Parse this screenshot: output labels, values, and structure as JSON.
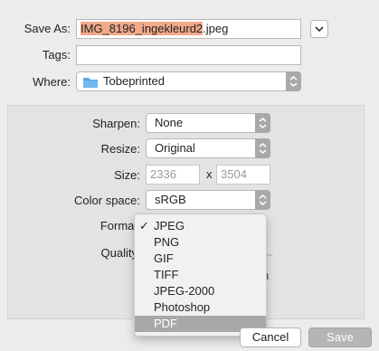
{
  "save_as": {
    "label": "Save As:",
    "filename_selected": "IMG_8196_ingekleurd2",
    "filename_ext": ".jpeg"
  },
  "tags": {
    "label": "Tags:",
    "value": ""
  },
  "where": {
    "label": "Where:",
    "folder": "Tobeprinted"
  },
  "options": {
    "sharpen": {
      "label": "Sharpen:",
      "value": "None"
    },
    "resize": {
      "label": "Resize:",
      "value": "Original"
    },
    "size": {
      "label": "Size:",
      "width": "2336",
      "separator": "x",
      "height": "3504"
    },
    "color_space": {
      "label": "Color space:",
      "value": "sRGB"
    },
    "format": {
      "label": "Format"
    },
    "quality": {
      "label": "Quality"
    },
    "hidden_edge_text": "h"
  },
  "format_menu": {
    "items": [
      {
        "label": "JPEG",
        "checked": true
      },
      {
        "label": "PNG"
      },
      {
        "label": "GIF"
      },
      {
        "label": "TIFF"
      },
      {
        "label": "JPEG-2000"
      },
      {
        "label": "Photoshop"
      },
      {
        "label": "PDF",
        "highlighted": true
      }
    ],
    "check_glyph": "✓"
  },
  "buttons": {
    "cancel": "Cancel",
    "save": "Save"
  },
  "colors": {
    "selection": "#f2a98a",
    "folder": "#5aa9e6",
    "menu_highlight": "#a8a8a8"
  }
}
